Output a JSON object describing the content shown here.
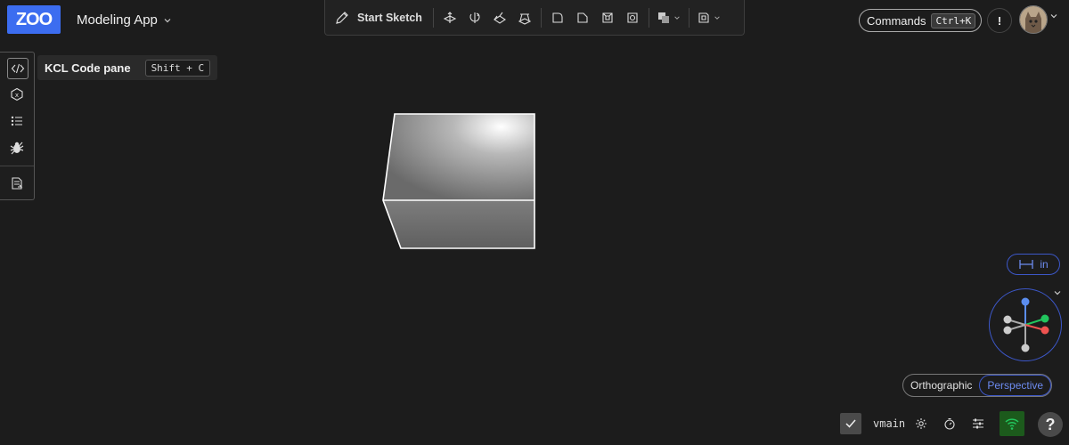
{
  "header": {
    "logo_text": "ZOO",
    "app_name": "Modeling App",
    "app_chevron": "chevron-down-icon"
  },
  "toolbar": {
    "start_sketch_label": "Start Sketch",
    "icons": [
      "extrude-icon",
      "revolve-icon",
      "sweep-icon",
      "loft-icon",
      "fillet-icon",
      "chamfer-icon",
      "shell-icon",
      "hole-icon",
      "union-icon",
      "plane-icon"
    ]
  },
  "top_right": {
    "commands_label": "Commands",
    "commands_shortcut": "Ctrl+K",
    "alert_label": "!"
  },
  "sidebar": {
    "items": [
      {
        "name": "kcl-code-pane",
        "icon": "code-icon"
      },
      {
        "name": "feature-tree",
        "icon": "hexagon-icon"
      },
      {
        "name": "variables",
        "icon": "list-icon"
      },
      {
        "name": "debug",
        "icon": "bug-icon"
      },
      {
        "name": "export",
        "icon": "file-export-icon"
      }
    ]
  },
  "tooltip": {
    "label": "KCL Code pane",
    "shortcut": "Shift + C"
  },
  "viewport": {
    "units_label": "in",
    "projection": {
      "options": [
        "Orthographic",
        "Perspective"
      ],
      "selected": "Perspective"
    }
  },
  "bottom_bar": {
    "branch": "vmain",
    "help_label": "?"
  },
  "colors": {
    "accent": "#3c6df0",
    "background": "#1c1c1c",
    "axis_x": "#ef5350",
    "axis_y": "#22c55e",
    "axis_z": "#5b8def",
    "network_ok": "#22c55e"
  }
}
